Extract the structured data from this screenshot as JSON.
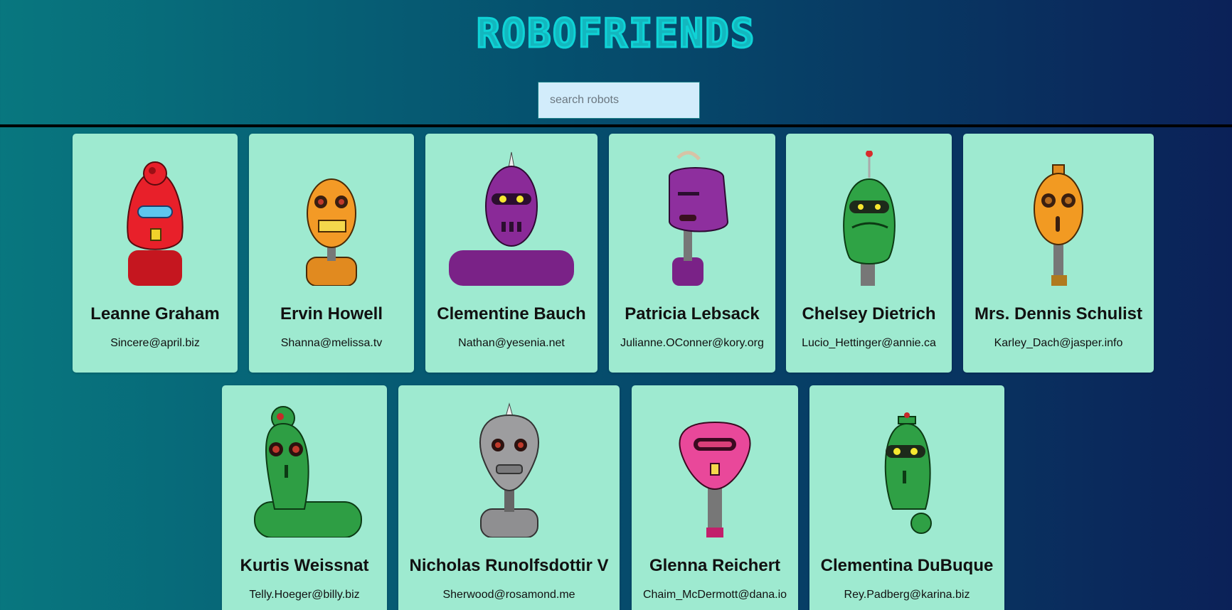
{
  "app": {
    "title": "ROBOFRIENDS"
  },
  "search": {
    "placeholder": "search robots",
    "value": ""
  },
  "robots": [
    {
      "name": "Leanne Graham",
      "email": "Sincere@april.biz",
      "color": "#e8202a"
    },
    {
      "name": "Ervin Howell",
      "email": "Shanna@melissa.tv",
      "color": "#f39a26"
    },
    {
      "name": "Clementine Bauch",
      "email": "Nathan@yesenia.net",
      "color": "#8a2a98"
    },
    {
      "name": "Patricia Lebsack",
      "email": "Julianne.OConner@kory.org",
      "color": "#8e2f9e"
    },
    {
      "name": "Chelsey Dietrich",
      "email": "Lucio_Hettinger@annie.ca",
      "color": "#2fa345"
    },
    {
      "name": "Mrs. Dennis Schulist",
      "email": "Karley_Dach@jasper.info",
      "color": "#f29a22"
    },
    {
      "name": "Kurtis Weissnat",
      "email": "Telly.Hoeger@billy.biz",
      "color": "#2e9e44"
    },
    {
      "name": "Nicholas Runolfsdottir V",
      "email": "Sherwood@rosamond.me",
      "color": "#9d9d9f"
    },
    {
      "name": "Glenna Reichert",
      "email": "Chaim_McDermott@dana.io",
      "color": "#e9489a"
    },
    {
      "name": "Clementina DuBuque",
      "email": "Rey.Padberg@karina.biz",
      "color": "#2fa045"
    }
  ]
}
